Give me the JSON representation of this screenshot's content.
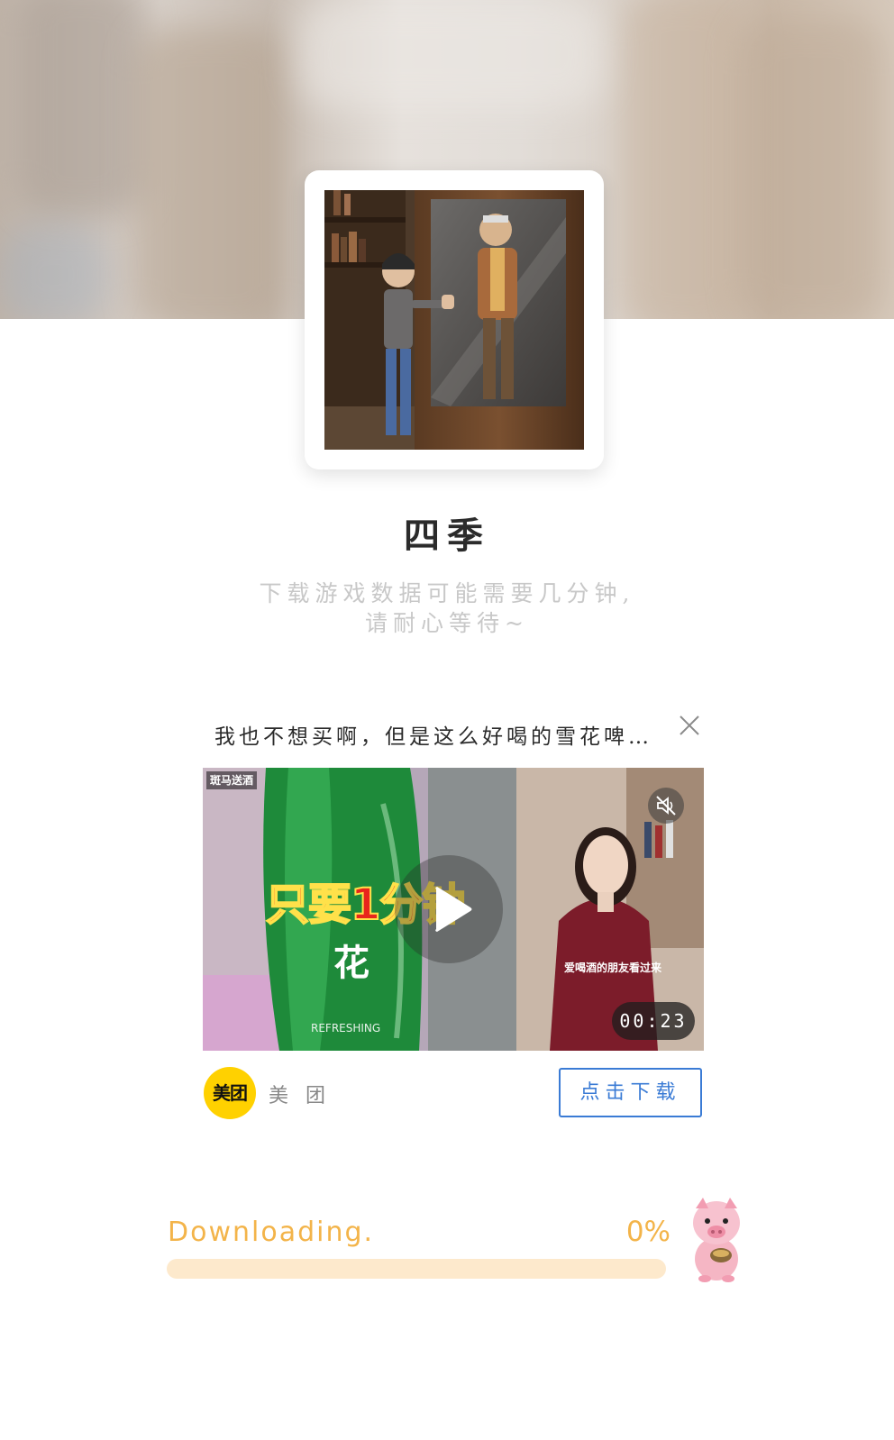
{
  "game": {
    "title": "四季",
    "loading_tip_line1": "下载游戏数据可能需要几分钟,",
    "loading_tip_line2": "请耐心等待~"
  },
  "ad": {
    "title": "我也不想买啊，但是这么好喝的雪花啤…",
    "video": {
      "overlay_text": "只要1分钟",
      "brand_tag": "斑马送酒",
      "subtitle": "爱喝酒的朋友看过来",
      "can_text": "REFRESHING",
      "duration": "00:23"
    },
    "advertiser": {
      "logo_text": "美团",
      "name": "美 团"
    },
    "cta_label": "点击下载"
  },
  "progress": {
    "label": "Downloading.",
    "percent_text": "0%",
    "value": 0
  },
  "colors": {
    "accent_orange": "#f3b44a",
    "track": "#fde9cc",
    "cta_blue": "#3a7bd5",
    "brand_yellow": "#ffd100"
  }
}
